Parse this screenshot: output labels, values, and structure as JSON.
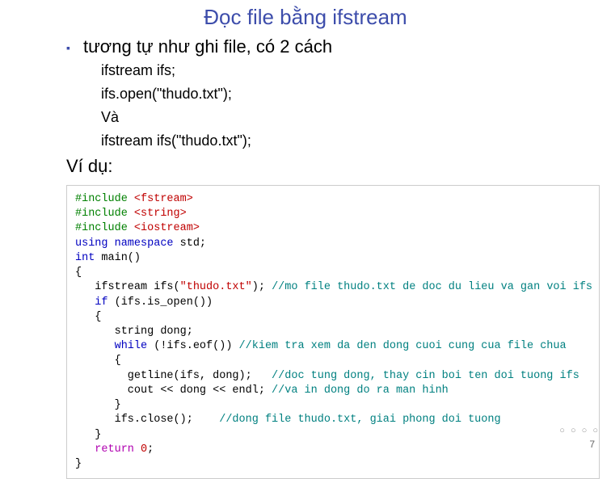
{
  "title": "Đọc file bằng ifstream",
  "bullet_text": "tương tự như ghi file, có 2 cách",
  "code_inline": {
    "l1": "ifstream ifs;",
    "l2": "ifs.open(\"thudo.txt\");",
    "l3": "Và",
    "l4": "ifstream ifs(\"thudo.txt\");"
  },
  "example_label": "Ví dụ:",
  "code": {
    "inc": "#include ",
    "hdr1": "<fstream>",
    "hdr2": "<string>",
    "hdr3": "<iostream>",
    "using": "using namespace ",
    "std": "std;",
    "int": "int ",
    "main": "main()",
    "ob": "{",
    "ifs_decl": "   ifstream ifs(",
    "fname": "\"thudo.txt\"",
    "ifs_close_paren": "); ",
    "cmt1": "//mo file thudo.txt de doc du lieu va gan voi ifs",
    "if_kw": "   if ",
    "if_cond": "(ifs.is_open())",
    "ob2": "   {",
    "str_decl": "      string dong;",
    "while_kw": "      while ",
    "while_cond": "(!ifs.eof()) ",
    "cmt2": "//kiem tra xem da den dong cuoi cung cua file chua",
    "ob3": "      {",
    "getline": "        getline(ifs, dong);   ",
    "cmt3": "//doc tung dong, thay cin boi ten doi tuong ifs",
    "cout": "        cout << dong << endl; ",
    "cmt4": "//va in dong do ra man hinh",
    "cb3": "      }",
    "close": "      ifs.close();    ",
    "cmt5": "//dong file thudo.txt, giai phong doi tuong",
    "cb2": "   }",
    "return": "   return ",
    "zero": "0",
    "semi": ";",
    "cb": "}"
  },
  "page_number": "7",
  "nav_glyph": "○ ○ ○ ○"
}
